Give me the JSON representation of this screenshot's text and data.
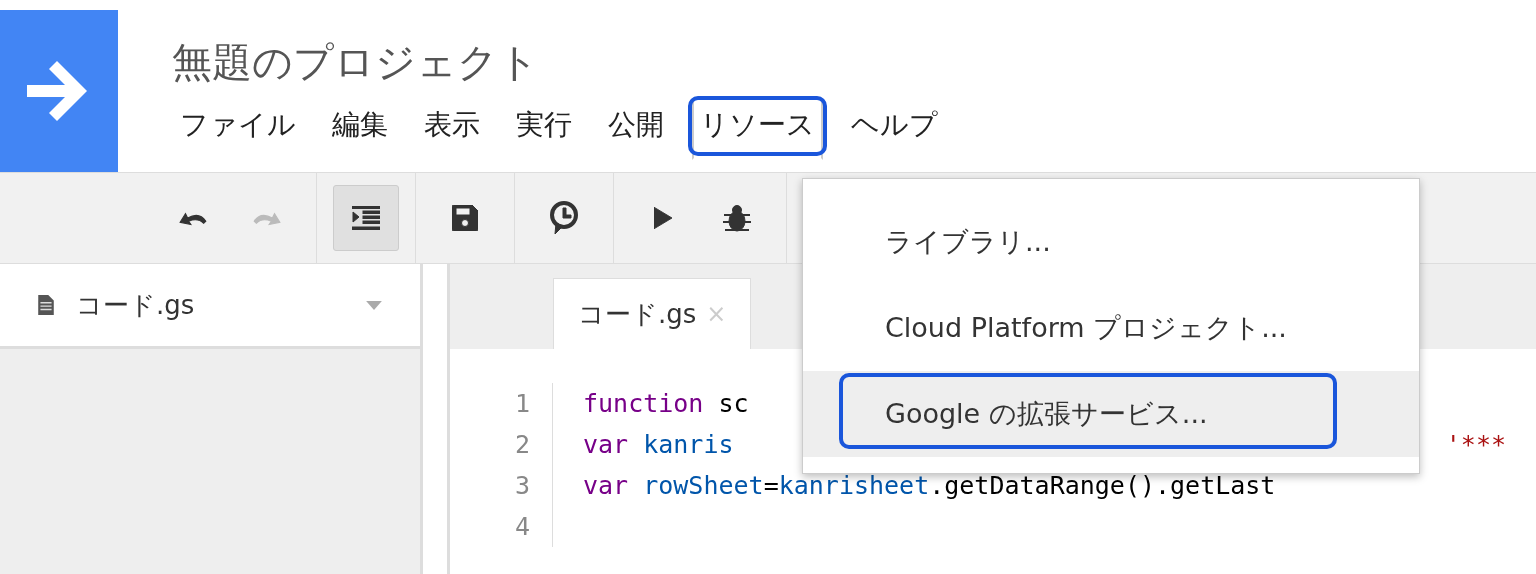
{
  "project_title": "無題のプロジェクト",
  "menu": [
    {
      "label": "ファイル",
      "selected": false,
      "annotated": false
    },
    {
      "label": "編集",
      "selected": false,
      "annotated": false
    },
    {
      "label": "表示",
      "selected": false,
      "annotated": false
    },
    {
      "label": "実行",
      "selected": false,
      "annotated": false
    },
    {
      "label": "公開",
      "selected": false,
      "annotated": false
    },
    {
      "label": "リソース",
      "selected": true,
      "annotated": true
    },
    {
      "label": "ヘルプ",
      "selected": false,
      "annotated": false
    }
  ],
  "toolbar": [
    {
      "kind": "undo",
      "disabled": false,
      "selected": false
    },
    {
      "kind": "redo",
      "disabled": true,
      "selected": false
    },
    {
      "kind": "indent",
      "disabled": false,
      "selected": true
    },
    {
      "kind": "save",
      "disabled": false,
      "selected": false
    },
    {
      "kind": "trigger",
      "disabled": false,
      "selected": false
    },
    {
      "kind": "run",
      "disabled": false,
      "selected": false
    },
    {
      "kind": "debug",
      "disabled": false,
      "selected": false
    }
  ],
  "file_list": [
    {
      "name": "コード.gs"
    }
  ],
  "editor_tabs": [
    {
      "label": "コード.gs",
      "selected": true,
      "close": "×"
    }
  ],
  "code_lines": [
    {
      "number": "1",
      "tokens": [
        {
          "kind": "keyword",
          "text": "function"
        },
        {
          "kind": "plain",
          "text": " sc"
        }
      ]
    },
    {
      "number": "2",
      "tokens": [
        {
          "kind": "keyword",
          "text": "var "
        },
        {
          "kind": "variable",
          "text": "kanris"
        },
        {
          "kind": "string",
          "text": "'***"
        }
      ]
    },
    {
      "number": "3",
      "tokens": [
        {
          "kind": "keyword",
          "text": "var "
        },
        {
          "kind": "variable",
          "text": "rowSheet"
        },
        {
          "kind": "plain",
          "text": "="
        },
        {
          "kind": "variable",
          "text": "kanrisheet"
        },
        {
          "kind": "plain",
          "text": ".getDataRange().getLast"
        }
      ]
    },
    {
      "number": "4"
    }
  ],
  "dropdown": [
    {
      "label": "ライブラリ...",
      "hovered": false,
      "annotated": false
    },
    {
      "label": "Cloud Platform プロジェクト...",
      "hovered": false,
      "annotated": false
    },
    {
      "label": "Google の拡張サービス...",
      "hovered": true,
      "annotated": true
    }
  ]
}
